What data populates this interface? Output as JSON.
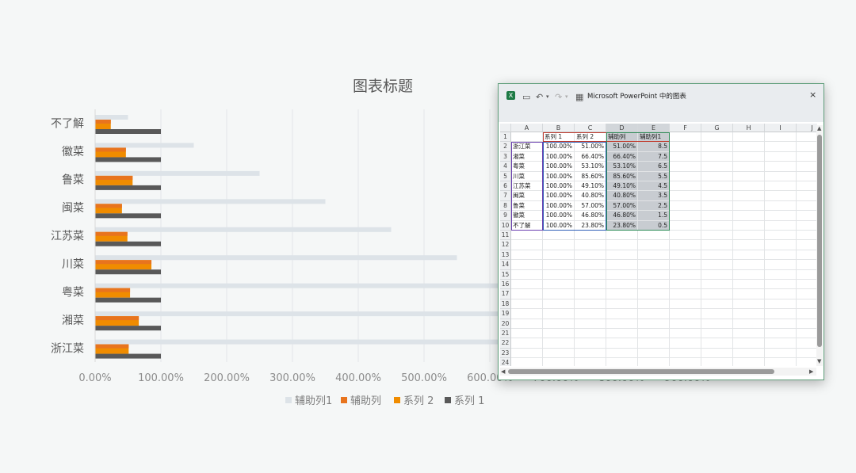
{
  "chart_data": {
    "type": "bar",
    "orientation": "horizontal",
    "title": "图表标题",
    "categories": [
      "不了解",
      "徽菜",
      "鲁菜",
      "闽菜",
      "江苏菜",
      "川菜",
      "粤菜",
      "湘菜",
      "浙江菜"
    ],
    "series": [
      {
        "name": "辅助列1",
        "color": "#dde3e8",
        "values": [
          0.5,
          1.5,
          2.5,
          3.5,
          4.5,
          5.5,
          6.5,
          7.5,
          8.5
        ]
      },
      {
        "name": "辅助列",
        "color": "#e8741e",
        "values": [
          0.238,
          0.468,
          0.57,
          0.408,
          0.491,
          0.856,
          0.531,
          0.664,
          0.51
        ]
      },
      {
        "name": "系列 2",
        "color": "#f08c00",
        "values": [
          0.238,
          0.468,
          0.57,
          0.408,
          0.491,
          0.856,
          0.531,
          0.664,
          0.51
        ]
      },
      {
        "name": "系列 1",
        "color": "#595959",
        "values": [
          1,
          1,
          1,
          1,
          1,
          1,
          1,
          1,
          1
        ]
      }
    ],
    "xticks": [
      "0.00%",
      "100.00%",
      "200.00%",
      "300.00%",
      "400.00%",
      "500.00%",
      "600.00%",
      "700.00%",
      "800.00%",
      "900.00%"
    ],
    "xlim": [
      0,
      9
    ],
    "grid": true,
    "legend": "bottom",
    "legend_order": [
      "辅助列1",
      "辅助列",
      "系列 2",
      "系列 1"
    ]
  },
  "excel": {
    "window_title": "Microsoft PowerPoint 中的图表",
    "close_label": "×",
    "columns": [
      "A",
      "B",
      "C",
      "D",
      "E",
      "F",
      "G",
      "H",
      "I",
      "J"
    ],
    "header_row": [
      "",
      "系列 1",
      "系列 2",
      "辅助列",
      "辅助列1"
    ],
    "rows": [
      [
        "浙江菜",
        "100.00%",
        "51.00%",
        "51.00%",
        "8.5"
      ],
      [
        "湘菜",
        "100.00%",
        "66.40%",
        "66.40%",
        "7.5"
      ],
      [
        "粤菜",
        "100.00%",
        "53.10%",
        "53.10%",
        "6.5"
      ],
      [
        "川菜",
        "100.00%",
        "85.60%",
        "85.60%",
        "5.5"
      ],
      [
        "江苏菜",
        "100.00%",
        "49.10%",
        "49.10%",
        "4.5"
      ],
      [
        "闽菜",
        "100.00%",
        "40.80%",
        "40.80%",
        "3.5"
      ],
      [
        "鲁菜",
        "100.00%",
        "57.00%",
        "57.00%",
        "2.5"
      ],
      [
        "徽菜",
        "100.00%",
        "46.80%",
        "46.80%",
        "1.5"
      ],
      [
        "不了解",
        "100.00%",
        "23.80%",
        "23.80%",
        "0.5"
      ]
    ],
    "row_numbers": [
      "1",
      "2",
      "3",
      "4",
      "5",
      "6",
      "7",
      "8",
      "9",
      "10",
      "11",
      "12",
      "13",
      "14",
      "15",
      "16",
      "17",
      "18",
      "19",
      "20",
      "21",
      "22",
      "23",
      "24"
    ]
  }
}
